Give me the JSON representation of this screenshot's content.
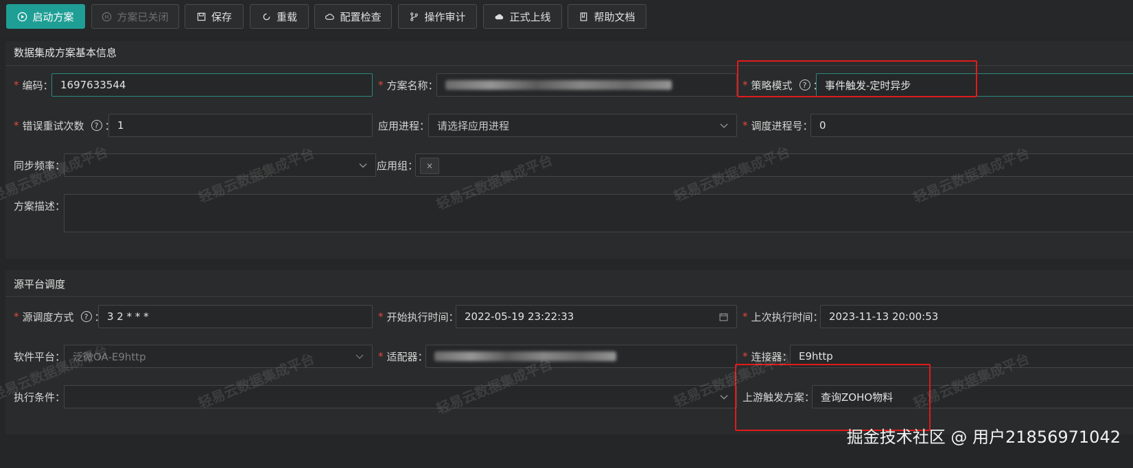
{
  "toolbar": {
    "start": "启动方案",
    "closed": "方案已关闭",
    "save": "保存",
    "reload": "重载",
    "config_check": "配置检查",
    "audit": "操作审计",
    "deploy": "正式上线",
    "help_doc": "帮助文档"
  },
  "basic": {
    "title": "数据集成方案基本信息",
    "code_label": "编码",
    "code_value": "1697633544",
    "name_label": "方案名称",
    "strategy_label": "策略模式",
    "strategy_value": "事件触发-定时异步",
    "retry_label": "错误重试次数",
    "retry_value": "1",
    "app_process_label": "应用进程",
    "app_process_placeholder": "请选择应用进程",
    "schedule_label": "调度进程号",
    "schedule_value": "0",
    "sync_label": "同步频率",
    "app_group_label": "应用组",
    "tag_close": "×",
    "desc_label": "方案描述"
  },
  "source": {
    "title": "源平台调度",
    "method_label": "源调度方式",
    "method_value": "3 2 * * *",
    "start_label": "开始执行时间",
    "start_value": "2022-05-19 23:22:33",
    "last_label": "上次执行时间",
    "last_value": "2023-11-13 20:00:53",
    "platform_label": "软件平台",
    "platform_value": "泛微OA-E9http",
    "adapter_label": "适配器",
    "connector_label": "连接器",
    "connector_value": "E9http",
    "cond_label": "执行条件",
    "upstream_label": "上游触发方案",
    "upstream_value": "查询ZOHO物料"
  },
  "watermark": "轻易云数据集成平台",
  "corner_watermark": "掘金技术社区 @ 用户21856971042",
  "colors": {
    "accent": "#1f9e95",
    "required": "#e0483e",
    "highlight_box": "#e21b1b"
  }
}
